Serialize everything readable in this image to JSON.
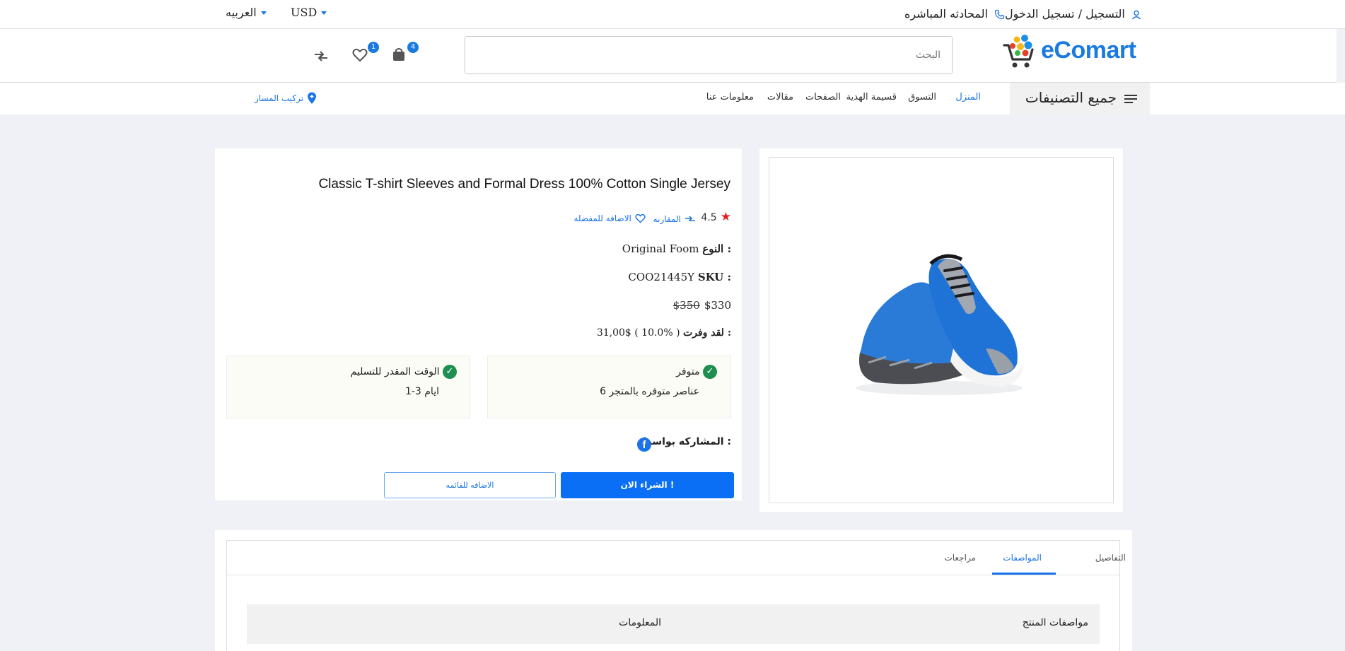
{
  "topbar": {
    "register_login": "التسجيل / تسجيل الدخول",
    "live_chat": "المحادثه المباشره",
    "currency": "USD",
    "language": "العربيه"
  },
  "header": {
    "logo": "eComart",
    "search_placeholder": "البحث",
    "cart_count": "4",
    "wishlist_count": "1"
  },
  "nav": {
    "all_categories": "جميع التصنيفات",
    "items": [
      "المنزل",
      "التسوق",
      "قسيمة الهدية",
      "الصفحات",
      "مقالات",
      "معلومات عنا"
    ],
    "track_order": "تركيب المسار"
  },
  "product": {
    "title": "Classic T-shirt Sleeves and Formal Dress 100% Cotton Single Jersey",
    "rating": "4.5",
    "compare": "المقارنه",
    "add_to_wishlist": "الاضافه للمفضله",
    "type_label": "النوع :",
    "type_value": "Original Foom",
    "sku_label": "SKU :",
    "sku_value": "COO21445Y",
    "old_price": "$350",
    "price": "$330",
    "saved_label": "لقد وفرت :",
    "saved_value": "31,00$ ( 10.0% )",
    "stock_title": "متوفر",
    "stock_detail": "6 عناصر متوفره بالمتجر",
    "delivery_title": "الوقت المقدر للتسليم",
    "delivery_detail": "1-3 ايام",
    "share_label": "المشاركه بواسطه :",
    "buy_now": "الشراء الان !",
    "add_to_list": "الاضافه للقائمه"
  },
  "tabs": {
    "items": [
      "التفاصيل",
      "المواصفات",
      "مراجعات"
    ],
    "active": "المواصفات"
  },
  "specs": {
    "col_product": "مواصفات المنتج",
    "col_info": "المعلومات"
  },
  "colors": {
    "accent": "#1a7ae0",
    "button": "#0a6ff5",
    "check": "#1e8f4e",
    "star": "#e32020"
  }
}
